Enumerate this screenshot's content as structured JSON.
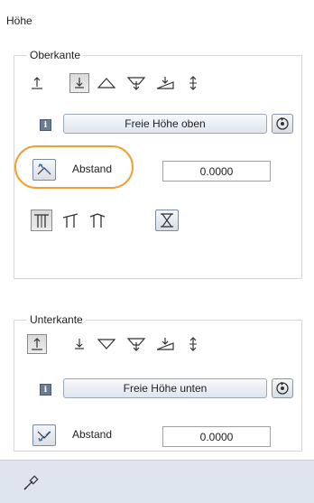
{
  "panel": {
    "title": "Höhe"
  },
  "oberkante": {
    "legend": "Oberkante",
    "button_label": "Freie Höhe oben",
    "abstand_label": "Abstand",
    "abstand_value": "0.0000",
    "icons": [
      "arrow-up-to-line-icon",
      "arrow-down-to-line-icon",
      "triangle-up-icon",
      "funnel-down-icon",
      "incline-down-icon",
      "double-arrow-vertical-icon"
    ]
  },
  "unterkante": {
    "legend": "Unterkante",
    "button_label": "Freie Höhe unten",
    "abstand_label": "Abstand",
    "abstand_value": "0.0000"
  },
  "colors": {
    "highlight": "#f0a030",
    "footer_bg": "#dfe5ef",
    "accent_blue": "#3a6ea5"
  }
}
